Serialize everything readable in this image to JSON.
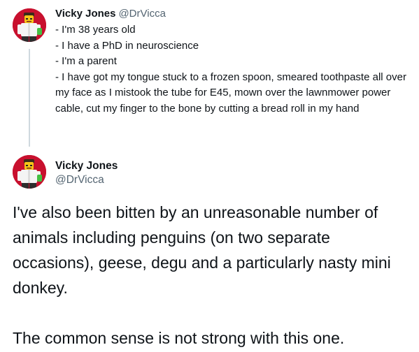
{
  "tweets": [
    {
      "display_name": "Vicky Jones",
      "handle": "@DrVicca",
      "lines": [
        "- I'm 38 years old",
        "- I have a PhD in neuroscience",
        "- I'm a parent",
        "- I have got my tongue stuck to a frozen spoon, smeared toothpaste all over my face as I mistook the tube for E45, mown over the lawnmower power cable, cut my finger to the bone by cutting a bread roll in my hand"
      ]
    },
    {
      "display_name": "Vicky Jones",
      "handle": "@DrVicca",
      "paragraphs": [
        "I've also been bitten by an unreasonable number of animals including penguins (on two separate occasions), geese, degu and a particularly nasty mini donkey.",
        "The common sense is not strong with this one."
      ]
    }
  ],
  "colors": {
    "text": "#0f1419",
    "secondary_text": "#536471",
    "thread_line": "#cfd9de",
    "avatar_background": "#c8102e"
  },
  "icons": {
    "avatar": "lego-scientist-avatar"
  }
}
